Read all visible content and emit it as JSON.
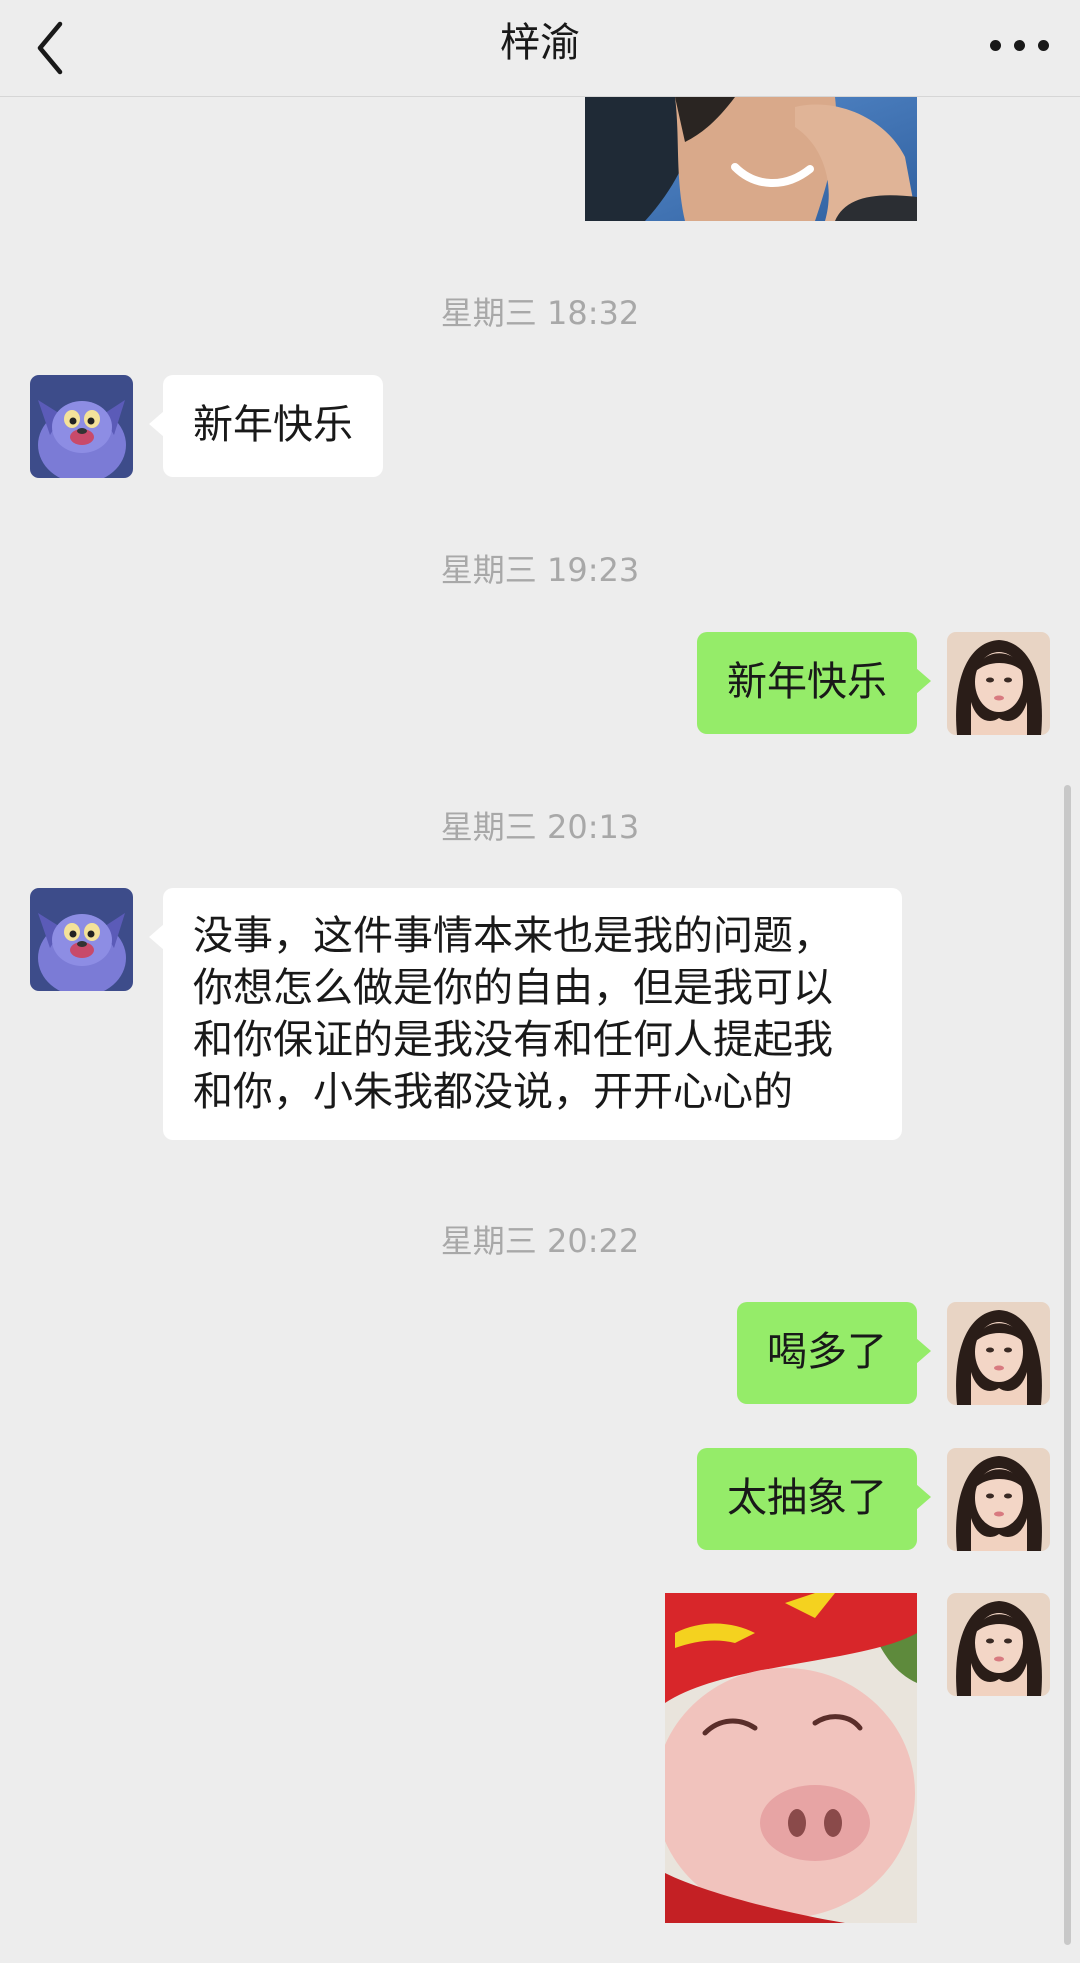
{
  "header": {
    "title": "梓渝"
  },
  "messages": {
    "ts1": "星期三 18:32",
    "m1": "新年快乐",
    "ts2": "星期三 19:23",
    "m2": "新年快乐",
    "ts3": "星期三 20:13",
    "m3_lines": [
      "没事，这件事情本来也是我的问题，",
      "你想怎么做是你的自由，但是我可以",
      "和你保证的是我没有和任何人提起我",
      "和你，小朱我都没说，开开心心的"
    ],
    "ts4": "星期三 20:22",
    "m4": "喝多了",
    "m5": "太抽象了"
  },
  "icons": {
    "back": "chevron-left-icon",
    "more": "more-dots-icon"
  },
  "colors": {
    "background": "#ededed",
    "sent_bubble": "#95ec69",
    "received_bubble": "#ffffff",
    "timestamp": "#a8a8a8"
  }
}
